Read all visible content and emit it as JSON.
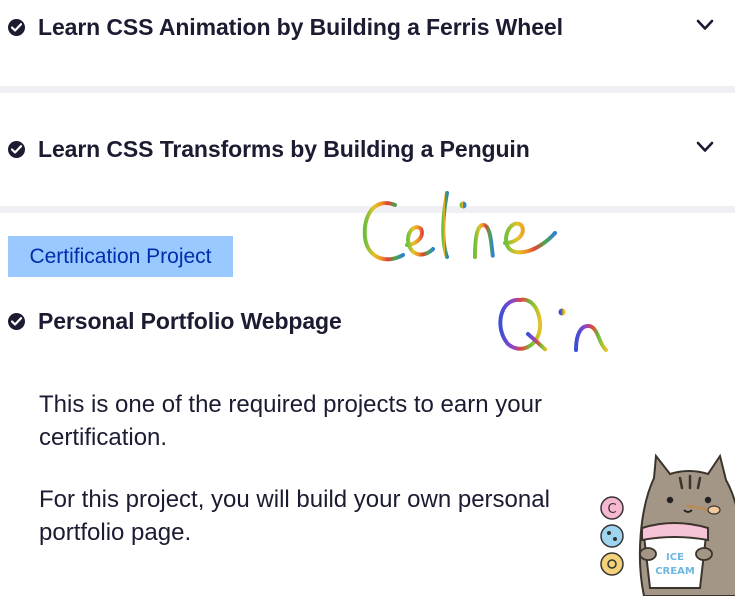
{
  "sections": [
    {
      "title": "Learn CSS Animation by Building a Ferris Wheel",
      "expand_icon": "chevron-down-icon",
      "status_icon": "check-circle-icon"
    },
    {
      "title": "Learn CSS Transforms by Building a Penguin",
      "expand_icon": "chevron-down-icon",
      "status_icon": "check-circle-icon"
    }
  ],
  "certification": {
    "badge": "Certification Project",
    "project_title": "Personal Portfolio Webpage",
    "status_icon": "check-circle-icon",
    "description": [
      "This is one of the required projects to earn your certification.",
      "For this project, you will build your own personal portfolio page."
    ]
  },
  "decorations": {
    "signature_first": "Celine",
    "signature_last": "Qin",
    "sticker": "pusheen-ice-cream-sticker",
    "sticker_text": "ICE CREAM"
  },
  "colors": {
    "text": "#1b1b32",
    "badge_bg": "#99c9ff",
    "badge_text": "#002ead",
    "separator": "#f0f0f4"
  }
}
